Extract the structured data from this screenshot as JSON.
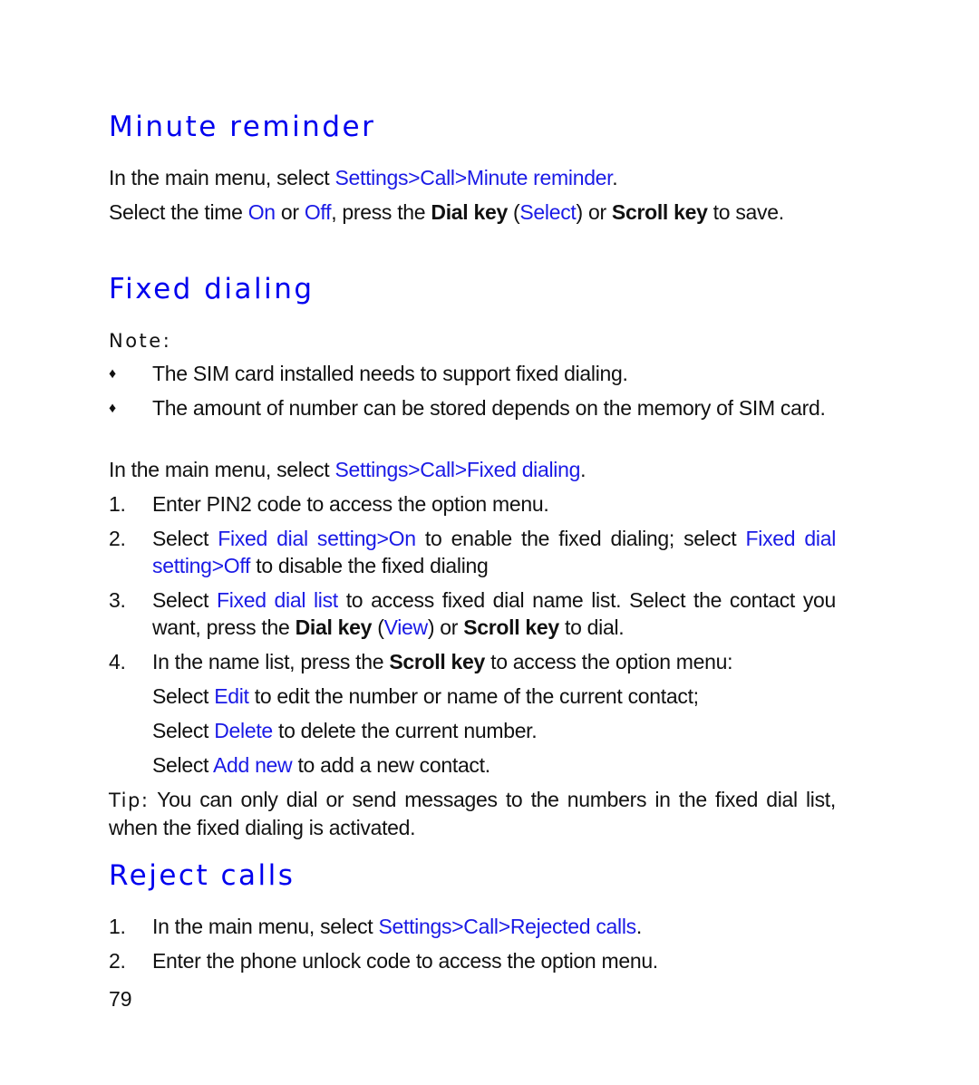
{
  "section_minute": {
    "title": "Minute reminder",
    "line1": {
      "pre": "In the main menu, select ",
      "link": "Settings>Call>Minute reminder",
      "post": "."
    },
    "line2": {
      "t1": "Select the time ",
      "on": "On",
      "t2": " or ",
      "off": "Off",
      "t3": ", press the ",
      "dial": "Dial key",
      "t4": " (",
      "select": "Select",
      "t5": ") or ",
      "scroll": "Scroll key",
      "t6": " to save."
    }
  },
  "section_fixed": {
    "title": "Fixed dialing",
    "note_label": "Note:",
    "bullets": [
      "The SIM card installed needs to support fixed dialing.",
      "The amount of number can be stored depends on the memory of SIM card."
    ],
    "bullet_marker": "♦",
    "menu_line": {
      "pre": "In the main menu, select ",
      "link": "Settings>Call>Fixed dialing",
      "post": "."
    },
    "steps": {
      "s1": {
        "num": "1.",
        "text": "Enter PIN2 code to access the option menu."
      },
      "s2": {
        "num": "2.",
        "t1": "Select ",
        "l1": "Fixed dial setting>On",
        "t2": " to enable the fixed dialing; select ",
        "l2": "Fixed dial setting>Off",
        "t3": " to disable the fixed dialing"
      },
      "s3": {
        "num": "3.",
        "t1": "Select ",
        "l1": "Fixed dial list",
        "t2": " to access fixed dial name list. Select the contact you want, press the ",
        "b1": "Dial key",
        "t3": " (",
        "l2": "View",
        "t4": ") or ",
        "b2": "Scroll key",
        "t5": " to dial."
      },
      "s4": {
        "num": "4.",
        "t1": "In the name list, press the ",
        "b1": "Scroll key",
        "t2": " to access the option menu:"
      }
    },
    "sub_items": [
      {
        "pre": "Select ",
        "link": "Edit",
        "post": " to edit the number or name of the current contact;"
      },
      {
        "pre": "Select ",
        "link": "Delete",
        "post": " to delete the current number."
      },
      {
        "pre": "Select ",
        "link": "Add new",
        "post": " to add a new contact."
      }
    ],
    "tip": {
      "label": "Tip:",
      "text": " You can only dial or send messages to the numbers in the fixed dial list, when the fixed dialing is activated."
    }
  },
  "section_reject": {
    "title": "Reject calls",
    "steps": [
      {
        "num": "1.",
        "pre": "In the main menu, select ",
        "link": "Settings>Call>Rejected calls",
        "post": "."
      },
      {
        "num": "2.",
        "text": "Enter the phone unlock code to access the option menu."
      }
    ]
  },
  "page_number": "79"
}
